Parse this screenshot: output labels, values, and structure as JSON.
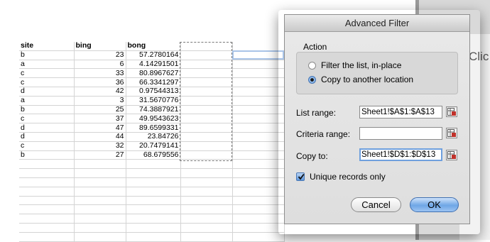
{
  "sheet": {
    "headers": [
      "site",
      "bing",
      "bong"
    ],
    "rows": [
      [
        "b",
        "23",
        "57.2780164"
      ],
      [
        "a",
        "6",
        "4.14291501"
      ],
      [
        "c",
        "33",
        "80.8967627"
      ],
      [
        "c",
        "36",
        "66.3341297"
      ],
      [
        "d",
        "42",
        "0.97544313"
      ],
      [
        "a",
        "3",
        "31.5670776"
      ],
      [
        "b",
        "25",
        "74.3887921"
      ],
      [
        "c",
        "37",
        "49.9543623"
      ],
      [
        "d",
        "47",
        "89.6599331"
      ],
      [
        "d",
        "44",
        "23.84726"
      ],
      [
        "c",
        "32",
        "20.7479141"
      ],
      [
        "b",
        "27",
        "68.679556"
      ]
    ],
    "empty_rows": 9
  },
  "right_panel": {
    "partial_text": "Clic"
  },
  "dialog": {
    "title": "Advanced Filter",
    "action_label": "Action",
    "radio_options": [
      {
        "label": "Filter the list, in-place",
        "selected": false
      },
      {
        "label": "Copy to another location",
        "selected": true
      }
    ],
    "list_range": {
      "label": "List range:",
      "value": "Sheet1!$A$1:$A$13"
    },
    "criteria_range": {
      "label": "Criteria range:",
      "value": ""
    },
    "copy_to": {
      "label": "Copy to:",
      "value": "Sheet1!$D$1:$D$13"
    },
    "unique_records": {
      "label": "Unique records only",
      "checked": true
    },
    "cancel_label": "Cancel",
    "ok_label": "OK"
  },
  "colors": {
    "accent": "#5d97dc",
    "focus_ring": "#6fa0de",
    "grid_line": "#d4d4d4"
  }
}
